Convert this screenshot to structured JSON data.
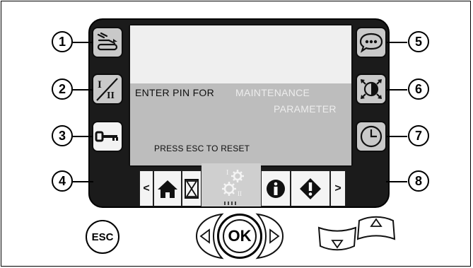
{
  "callouts": [
    "1",
    "2",
    "3",
    "4",
    "5",
    "6",
    "7",
    "8"
  ],
  "screen": {
    "line1_prefix": "ENTER PIN FOR",
    "line1_highlight": "MAINTENANCE",
    "line2_highlight": "PARAMETER",
    "reset_prompt": "PRESS ESC TO RESET"
  },
  "tabs": {
    "left_arrow": "<",
    "right_arrow": ">",
    "params_label": "I",
    "params_sub": "II"
  },
  "keys": {
    "esc_label": "ESC",
    "ok_label": "OK"
  },
  "side_buttons_left": [
    "drive-sequence-icon",
    "mode-switch-icon",
    "key-icon",
    "blank"
  ],
  "side_buttons_right": [
    "message-icon",
    "contrast-icon",
    "clock-icon",
    "blank"
  ],
  "tab_icons": [
    "home-icon",
    "hourglass-icon",
    "settings-gears-icon",
    "info-icon",
    "warning-icon"
  ],
  "colors": {
    "bezel": "#1b1b1b",
    "screen_top": "#efefef",
    "screen_band": "#bdbdbd",
    "highlight_text": "#ededed"
  }
}
